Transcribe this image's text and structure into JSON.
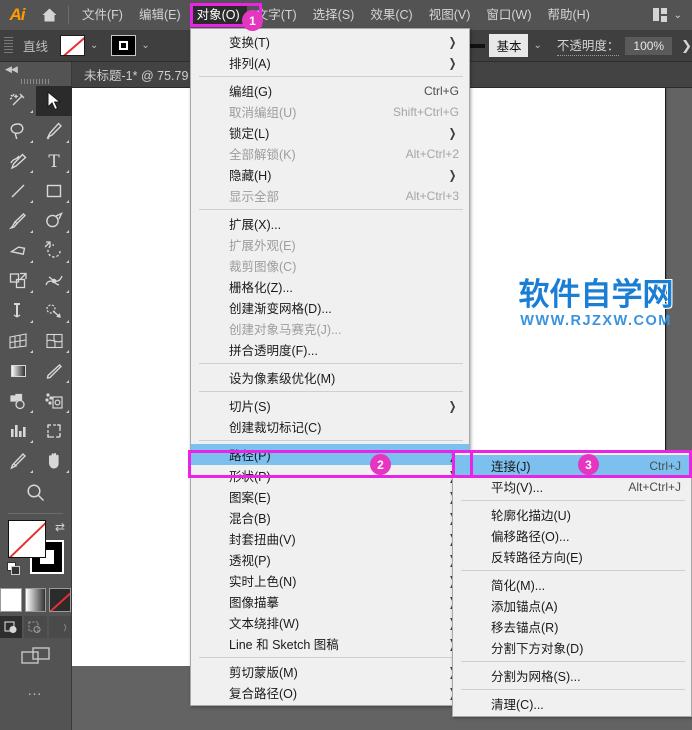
{
  "app": {
    "logo": "Ai",
    "home_icon": "home-icon"
  },
  "menubar": {
    "items": [
      {
        "label": "文件(F)",
        "active": false
      },
      {
        "label": "编辑(E)",
        "active": false
      },
      {
        "label": "对象(O)",
        "active": true
      },
      {
        "label": "文字(T)",
        "active": false
      },
      {
        "label": "选择(S)",
        "active": false
      },
      {
        "label": "效果(C)",
        "active": false
      },
      {
        "label": "视图(V)",
        "active": false
      },
      {
        "label": "窗口(W)",
        "active": false
      },
      {
        "label": "帮助(H)",
        "active": false
      }
    ],
    "workspace_icon": "workspace-grid-icon",
    "workspace_caret": "⌄"
  },
  "optionsbar": {
    "tool_label": "直线",
    "fill_swatch": "fill-none-swatch",
    "fill_caret": "⌄",
    "stroke_swatch": "stroke-black-swatch",
    "stroke_caret": "⌄",
    "stroke_profile": "basic-stroke-preview",
    "stroke_profile_label": "基本",
    "stroke_profile_caret": "⌄",
    "opacity_label": "不透明度：",
    "opacity_value": "100%",
    "overflow_caret": "❯"
  },
  "toolbox": {
    "collapse_icon": "collapse-left-icon",
    "tools": [
      {
        "name": "magic-wand-tool",
        "sel": false
      },
      {
        "name": "selection-tool",
        "sel": true
      },
      {
        "name": "lasso-tool",
        "sel": false
      },
      {
        "name": "pen-tool",
        "sel": false
      },
      {
        "name": "curvature-tool",
        "sel": false
      },
      {
        "name": "type-tool",
        "sel": false
      },
      {
        "name": "line-segment-tool",
        "sel": false
      },
      {
        "name": "rectangle-tool",
        "sel": false
      },
      {
        "name": "paintbrush-tool",
        "sel": false
      },
      {
        "name": "shaper-tool",
        "sel": false
      },
      {
        "name": "eraser-tool",
        "sel": false
      },
      {
        "name": "rotate-tool",
        "sel": false
      },
      {
        "name": "scale-tool",
        "sel": false
      },
      {
        "name": "width-tool",
        "sel": false
      },
      {
        "name": "free-transform-tool",
        "sel": false
      },
      {
        "name": "shape-builder-tool",
        "sel": false
      },
      {
        "name": "perspective-grid-tool",
        "sel": false
      },
      {
        "name": "mesh-tool",
        "sel": false
      },
      {
        "name": "gradient-tool",
        "sel": false
      },
      {
        "name": "eyedropper-tool",
        "sel": false
      },
      {
        "name": "blend-tool",
        "sel": false
      },
      {
        "name": "symbol-sprayer-tool",
        "sel": false
      },
      {
        "name": "column-graph-tool",
        "sel": false
      },
      {
        "name": "artboard-tool",
        "sel": false
      },
      {
        "name": "slice-tool",
        "sel": false
      },
      {
        "name": "hand-tool",
        "sel": false
      }
    ],
    "zoom_tool": "zoom-tool",
    "color_fill": "fill-color-none",
    "color_stroke": "stroke-color-black",
    "swap_icon": "swap-fill-stroke-icon",
    "default_icon": "default-fill-stroke-icon",
    "modes": [
      "color-mode-white",
      "gradient-mode",
      "none-mode"
    ],
    "draw_modes": [
      "draw-normal",
      "draw-behind",
      "draw-inside"
    ],
    "screen_mode": "screen-mode-icon",
    "more_tools": "…"
  },
  "document": {
    "tab_title": "未标题-1* @ 75.79",
    "watermark_main": "软件自学网",
    "watermark_sub": "WWW.RJZXW.COM"
  },
  "object_menu": {
    "items": [
      {
        "label": "变换(T)",
        "accel": "",
        "arrow": true,
        "disabled": false,
        "hl": false
      },
      {
        "label": "排列(A)",
        "accel": "",
        "arrow": true,
        "disabled": false,
        "hl": false
      },
      {
        "sep": true
      },
      {
        "label": "编组(G)",
        "accel": "Ctrl+G",
        "arrow": false,
        "disabled": false,
        "hl": false
      },
      {
        "label": "取消编组(U)",
        "accel": "Shift+Ctrl+G",
        "arrow": false,
        "disabled": true,
        "hl": false
      },
      {
        "label": "锁定(L)",
        "accel": "",
        "arrow": true,
        "disabled": false,
        "hl": false
      },
      {
        "label": "全部解锁(K)",
        "accel": "Alt+Ctrl+2",
        "arrow": false,
        "disabled": true,
        "hl": false
      },
      {
        "label": "隐藏(H)",
        "accel": "",
        "arrow": true,
        "disabled": false,
        "hl": false
      },
      {
        "label": "显示全部",
        "accel": "Alt+Ctrl+3",
        "arrow": false,
        "disabled": true,
        "hl": false
      },
      {
        "sep": true
      },
      {
        "label": "扩展(X)...",
        "accel": "",
        "arrow": false,
        "disabled": false,
        "hl": false
      },
      {
        "label": "扩展外观(E)",
        "accel": "",
        "arrow": false,
        "disabled": true,
        "hl": false
      },
      {
        "label": "裁剪图像(C)",
        "accel": "",
        "arrow": false,
        "disabled": true,
        "hl": false
      },
      {
        "label": "栅格化(Z)...",
        "accel": "",
        "arrow": false,
        "disabled": false,
        "hl": false
      },
      {
        "label": "创建渐变网格(D)...",
        "accel": "",
        "arrow": false,
        "disabled": false,
        "hl": false
      },
      {
        "label": "创建对象马赛克(J)...",
        "accel": "",
        "arrow": false,
        "disabled": true,
        "hl": false
      },
      {
        "label": "拼合透明度(F)...",
        "accel": "",
        "arrow": false,
        "disabled": false,
        "hl": false
      },
      {
        "sep": true
      },
      {
        "label": "设为像素级优化(M)",
        "accel": "",
        "arrow": false,
        "disabled": false,
        "hl": false
      },
      {
        "sep": true
      },
      {
        "label": "切片(S)",
        "accel": "",
        "arrow": true,
        "disabled": false,
        "hl": false
      },
      {
        "label": "创建裁切标记(C)",
        "accel": "",
        "arrow": false,
        "disabled": false,
        "hl": false
      },
      {
        "sep": true
      },
      {
        "label": "路径(P)",
        "accel": "",
        "arrow": true,
        "disabled": false,
        "hl": true
      },
      {
        "label": "形状(P)",
        "accel": "",
        "arrow": true,
        "disabled": false,
        "hl": false
      },
      {
        "label": "图案(E)",
        "accel": "",
        "arrow": true,
        "disabled": false,
        "hl": false
      },
      {
        "label": "混合(B)",
        "accel": "",
        "arrow": true,
        "disabled": false,
        "hl": false
      },
      {
        "label": "封套扭曲(V)",
        "accel": "",
        "arrow": true,
        "disabled": false,
        "hl": false
      },
      {
        "label": "透视(P)",
        "accel": "",
        "arrow": true,
        "disabled": false,
        "hl": false
      },
      {
        "label": "实时上色(N)",
        "accel": "",
        "arrow": true,
        "disabled": false,
        "hl": false
      },
      {
        "label": "图像描摹",
        "accel": "",
        "arrow": true,
        "disabled": false,
        "hl": false
      },
      {
        "label": "文本绕排(W)",
        "accel": "",
        "arrow": true,
        "disabled": false,
        "hl": false
      },
      {
        "label": "Line 和 Sketch 图稿",
        "accel": "",
        "arrow": true,
        "disabled": false,
        "hl": false
      },
      {
        "sep": true
      },
      {
        "label": "剪切蒙版(M)",
        "accel": "",
        "arrow": true,
        "disabled": false,
        "hl": false
      },
      {
        "label": "复合路径(O)",
        "accel": "",
        "arrow": true,
        "disabled": false,
        "hl": false
      }
    ]
  },
  "path_submenu": {
    "items": [
      {
        "label": "连接(J)",
        "accel": "Ctrl+J",
        "disabled": false,
        "hl": true
      },
      {
        "label": "平均(V)...",
        "accel": "Alt+Ctrl+J",
        "disabled": false,
        "hl": false
      },
      {
        "sep": true
      },
      {
        "label": "轮廓化描边(U)",
        "accel": "",
        "disabled": false,
        "hl": false
      },
      {
        "label": "偏移路径(O)...",
        "accel": "",
        "disabled": false,
        "hl": false
      },
      {
        "label": "反转路径方向(E)",
        "accel": "",
        "disabled": false,
        "hl": false
      },
      {
        "sep": true
      },
      {
        "label": "简化(M)...",
        "accel": "",
        "disabled": false,
        "hl": false
      },
      {
        "label": "添加锚点(A)",
        "accel": "",
        "disabled": false,
        "hl": false
      },
      {
        "label": "移去锚点(R)",
        "accel": "",
        "disabled": false,
        "hl": false
      },
      {
        "label": "分割下方对象(D)",
        "accel": "",
        "disabled": false,
        "hl": false
      },
      {
        "sep": true
      },
      {
        "label": "分割为网格(S)...",
        "accel": "",
        "disabled": false,
        "hl": false
      },
      {
        "sep": true
      },
      {
        "label": "清理(C)...",
        "accel": "",
        "disabled": false,
        "hl": false
      }
    ]
  },
  "annotations": {
    "step1": "1",
    "step2": "2",
    "step3": "3",
    "box_color": "#ea23e6",
    "badge_color": "#e536c0"
  }
}
